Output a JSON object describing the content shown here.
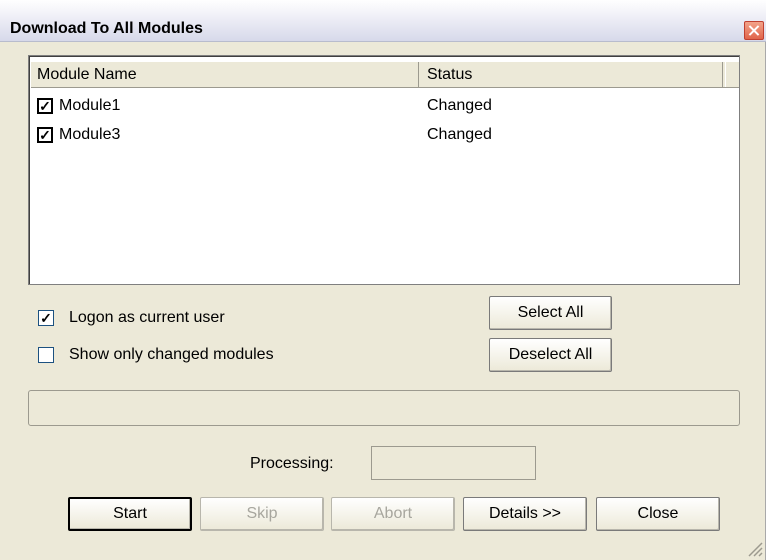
{
  "window": {
    "title": "Download To All Modules"
  },
  "list": {
    "columns": [
      "Module Name",
      "Status"
    ],
    "rows": [
      {
        "name": "Module1",
        "status": "Changed",
        "checked": true
      },
      {
        "name": "Module3",
        "status": "Changed",
        "checked": true
      }
    ]
  },
  "options": {
    "logon": {
      "label": "Logon as current user",
      "checked": true
    },
    "show_changed": {
      "label": "Show only changed modules",
      "checked": false
    }
  },
  "buttons": {
    "select_all": "Select All",
    "deselect_all": "Deselect All",
    "start": "Start",
    "skip": "Skip",
    "abort": "Abort",
    "details": "Details >>",
    "close": "Close"
  },
  "processing": {
    "label": "Processing:",
    "value": ""
  },
  "colors": {
    "dialog_bg": "#ece9d8",
    "close_button": "#e0644a"
  }
}
